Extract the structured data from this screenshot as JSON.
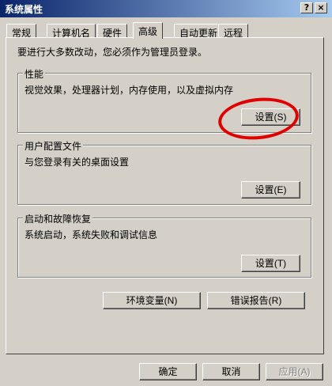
{
  "window": {
    "title": "系统属性",
    "help_label": "?",
    "close_label": "×"
  },
  "tabs": [
    "常规",
    "计算机名",
    "硬件",
    "高级",
    "自动更新",
    "远程"
  ],
  "intro": "要进行大多数改动，您必须作为管理员登录。",
  "groups": {
    "performance": {
      "title": "性能",
      "desc": "视觉效果，处理器计划，内存使用，以及虚拟内存",
      "button": "设置(S)"
    },
    "profile": {
      "title": "用户配置文件",
      "desc": "与您登录有关的桌面设置",
      "button": "设置(E)"
    },
    "startup": {
      "title": "启动和故障恢复",
      "desc": "系统启动，系统失败和调试信息",
      "button": "设置(T)"
    }
  },
  "env_button": "环境变量(N)",
  "error_button": "错误报告(R)",
  "footer": {
    "ok": "确定",
    "cancel": "取消",
    "apply": "应用(A)"
  },
  "colors": {
    "annotation": "#e00000",
    "titlebar": "#0a246a"
  }
}
